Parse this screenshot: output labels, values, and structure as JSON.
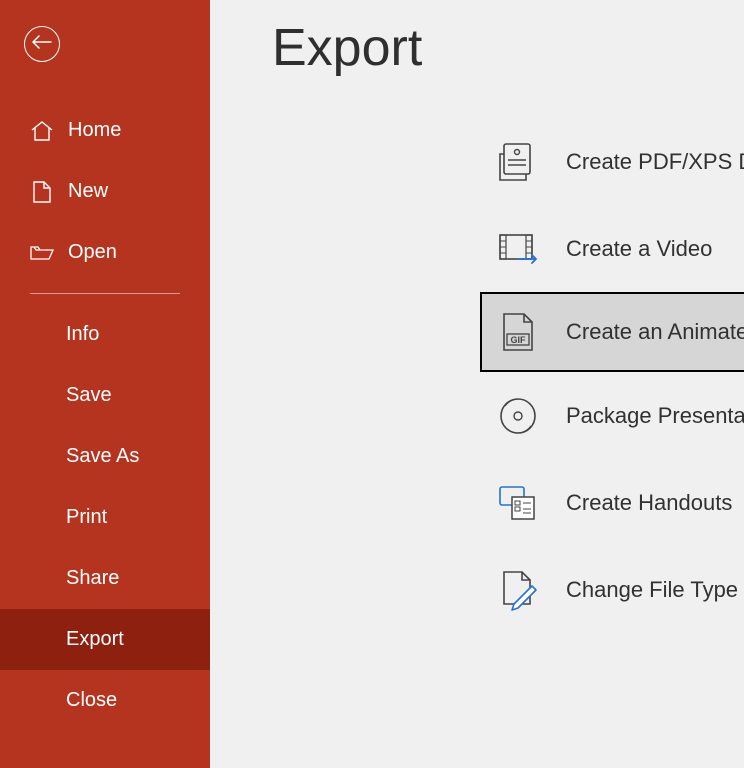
{
  "page": {
    "title": "Export"
  },
  "sidebar": {
    "top": [
      {
        "label": "Home"
      },
      {
        "label": "New"
      },
      {
        "label": "Open"
      }
    ],
    "items": [
      {
        "label": "Info"
      },
      {
        "label": "Save"
      },
      {
        "label": "Save As"
      },
      {
        "label": "Print"
      },
      {
        "label": "Share"
      },
      {
        "label": "Export"
      },
      {
        "label": "Close"
      }
    ]
  },
  "options": [
    {
      "label": "Create PDF/XPS Document"
    },
    {
      "label": "Create a Video"
    },
    {
      "label": "Create an Animated GIF"
    },
    {
      "label": "Package Presentation for CD"
    },
    {
      "label": "Create Handouts"
    },
    {
      "label": "Change File Type"
    }
  ]
}
